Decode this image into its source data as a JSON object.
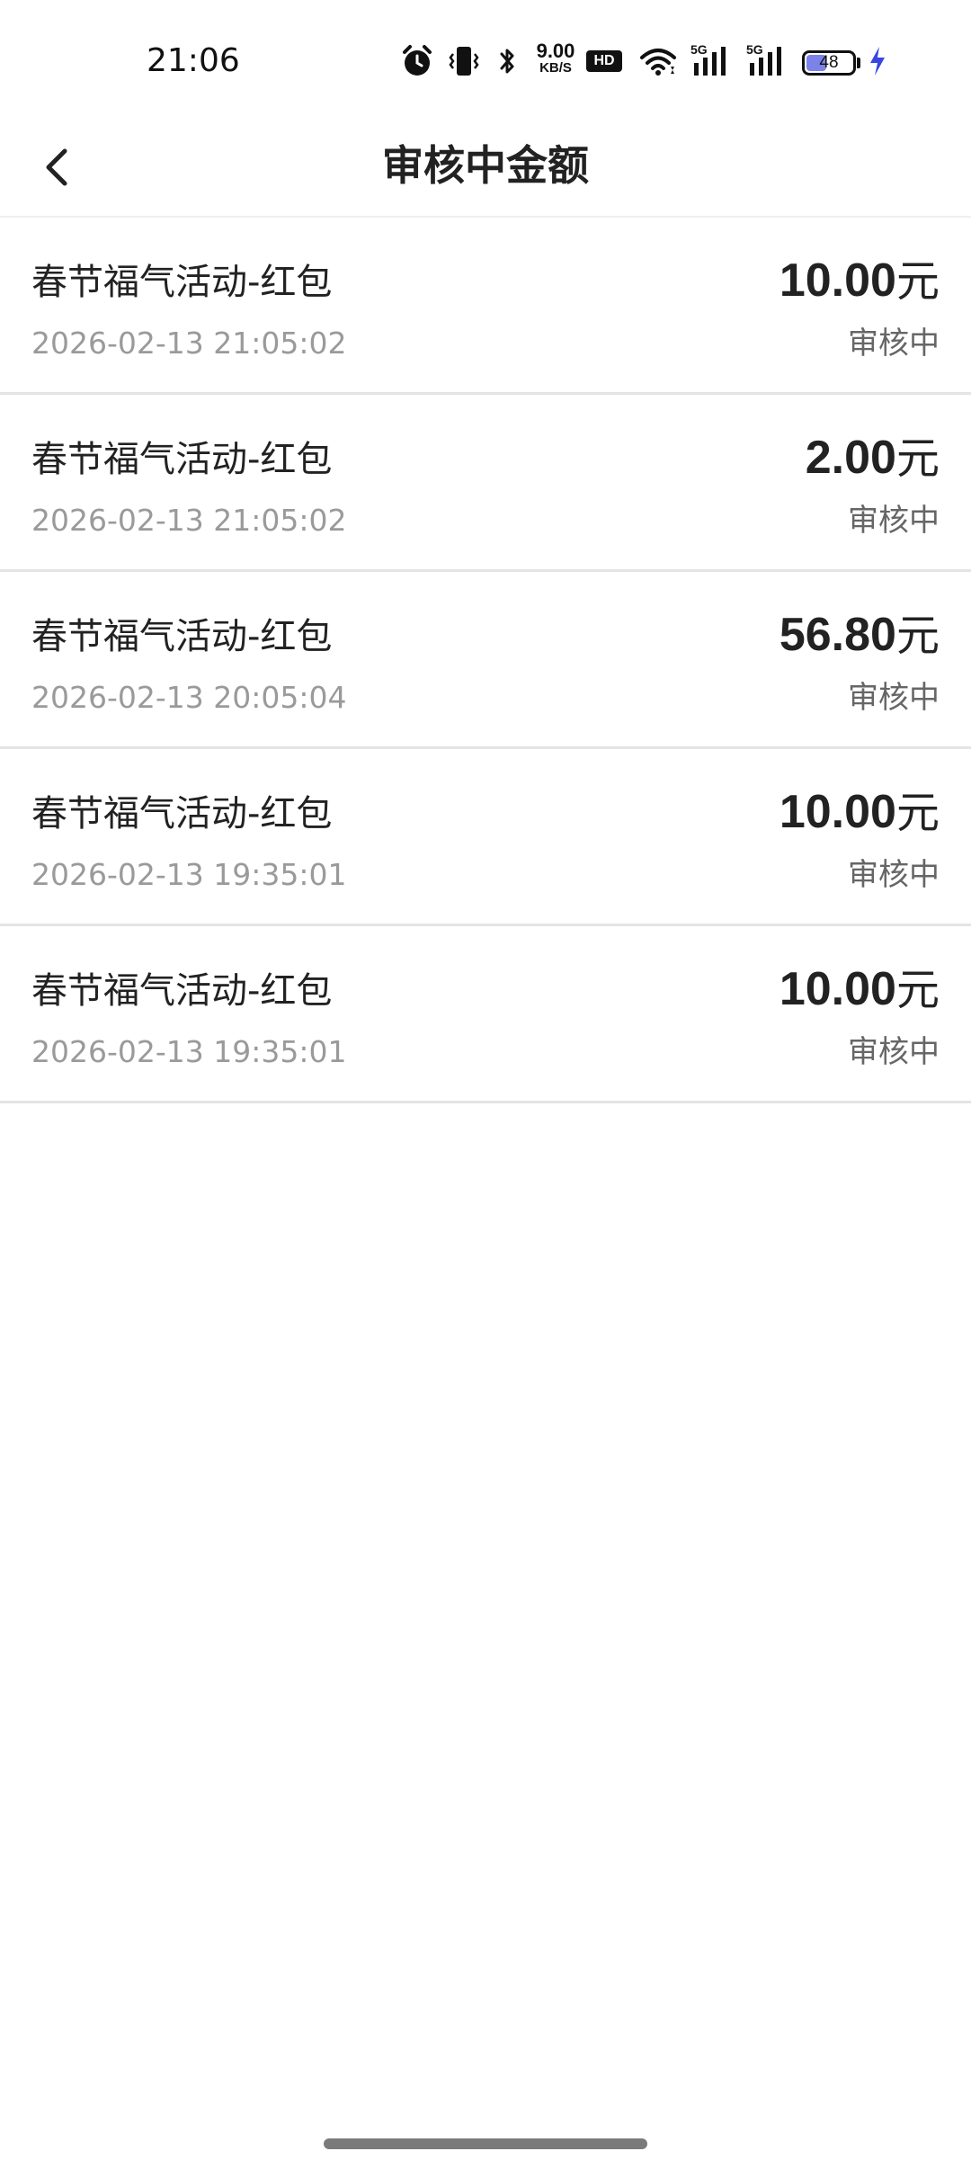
{
  "status_bar": {
    "time": "21:06",
    "net_speed_value": "9.00",
    "net_speed_unit": "KB/S",
    "hd_label": "HD",
    "signal1_label": "5G",
    "signal2_label": "5G",
    "battery_level": "48",
    "battery_percent": 48,
    "icons": [
      "alarm-icon",
      "vibrate-icon",
      "bluetooth-icon",
      "wifi-icon",
      "signal-icon",
      "signal-icon",
      "battery-icon",
      "charging-icon"
    ],
    "colors": {
      "battery_fill": "#7b83e8",
      "charging": "#3a46e0"
    }
  },
  "header": {
    "title": "审核中金额",
    "back_icon": "chevron-left-icon"
  },
  "records": [
    {
      "title": "春节福气活动-红包",
      "time": "2026-02-13 21:05:02",
      "amount": "10.00",
      "unit": "元",
      "status": "审核中"
    },
    {
      "title": "春节福气活动-红包",
      "time": "2026-02-13 21:05:02",
      "amount": "2.00",
      "unit": "元",
      "status": "审核中"
    },
    {
      "title": "春节福气活动-红包",
      "time": "2026-02-13 20:05:04",
      "amount": "56.80",
      "unit": "元",
      "status": "审核中"
    },
    {
      "title": "春节福气活动-红包",
      "time": "2026-02-13 19:35:01",
      "amount": "10.00",
      "unit": "元",
      "status": "审核中"
    },
    {
      "title": "春节福气活动-红包",
      "time": "2026-02-13 19:35:01",
      "amount": "10.00",
      "unit": "元",
      "status": "审核中"
    }
  ]
}
